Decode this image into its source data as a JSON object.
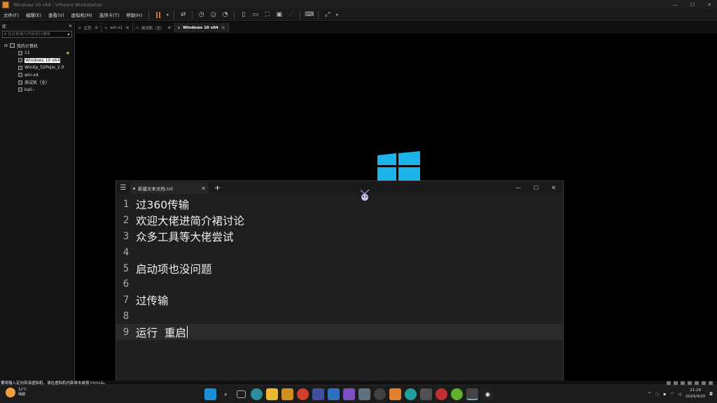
{
  "window": {
    "title": "Windows 10 x64 - VMware Workstation"
  },
  "menu": [
    "文件(F)",
    "编辑(E)",
    "查看(V)",
    "虚拟机(M)",
    "选项卡(T)",
    "帮助(H)"
  ],
  "library": {
    "header": "库",
    "search_placeholder": "在此处键入内容进行搜索",
    "root": "我的计算机",
    "items": [
      {
        "label": "11",
        "starred": true
      },
      {
        "label": "Windows 10 x64",
        "selected": true
      },
      {
        "label": "WinXp_52Pojie_2.0"
      },
      {
        "label": "win-x4"
      },
      {
        "label": "测试机（全）"
      },
      {
        "label": "kali--"
      }
    ]
  },
  "tabs": [
    {
      "label": "主页"
    },
    {
      "label": "win-s1"
    },
    {
      "label": "测试机（全）"
    },
    {
      "label": "Windows 10 x64",
      "active": true
    }
  ],
  "notepad": {
    "tab_title": "新建文本文档.txt",
    "current_line": 9,
    "lines": [
      {
        "n": "1",
        "text": "过360传输"
      },
      {
        "n": "2",
        "text": "欢迎大佬进简介裙讨论"
      },
      {
        "n": "3",
        "text": "众多工具等大佬尝试"
      },
      {
        "n": "4",
        "text": ""
      },
      {
        "n": "5",
        "text": "启动项也没问题"
      },
      {
        "n": "6",
        "text": ""
      },
      {
        "n": "7",
        "text": "过传输"
      },
      {
        "n": "8",
        "text": ""
      },
      {
        "n": "9",
        "text": "运行  重启"
      }
    ]
  },
  "status": {
    "message": "要将输入定向到该虚拟机，请在虚拟机内部单击或按 Ctrl+G。"
  },
  "taskbar": {
    "weather_temp": "12°C",
    "weather_desc": "晴朗",
    "time": "21:20",
    "date": "2024/4/20"
  },
  "colors": {
    "accent_windows": "#1ab4e8",
    "pause_orange": "#e07020"
  }
}
